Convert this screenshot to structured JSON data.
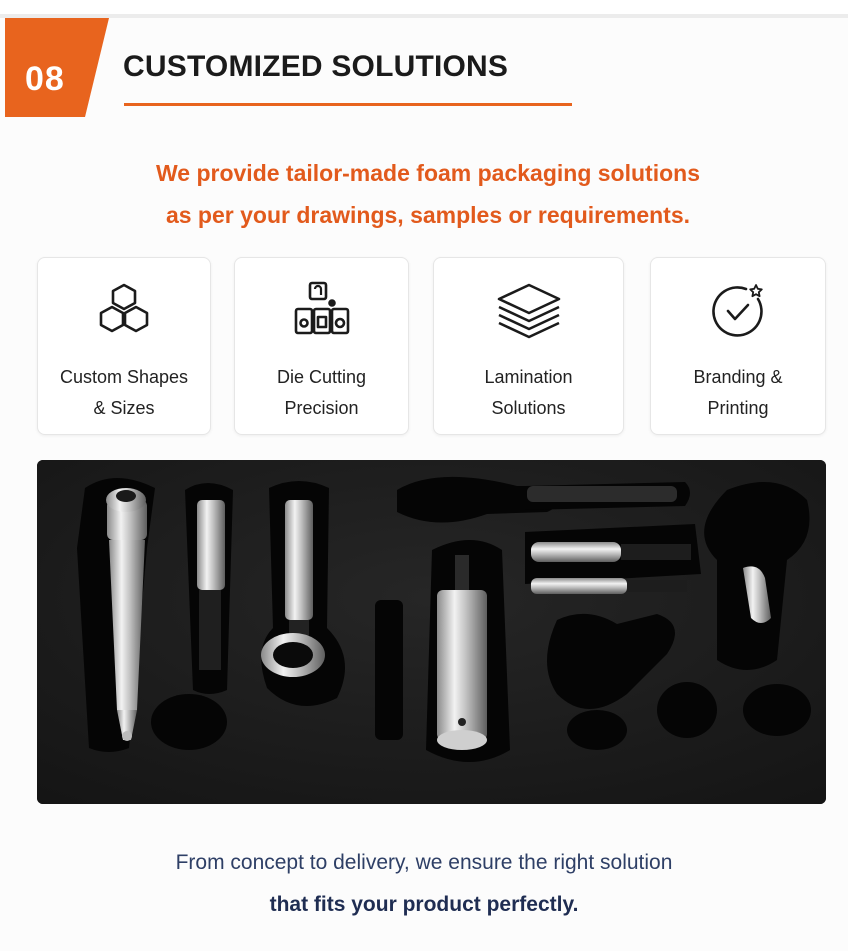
{
  "section": {
    "number": "08",
    "title": "CUSTOMIZED SOLUTIONS",
    "accent_color": "#e8641e"
  },
  "subtitle": {
    "line1": "We provide tailor-made foam packaging solutions",
    "line2": "as per your drawings, samples or requirements.",
    "color": "#e25a1c"
  },
  "features": [
    {
      "icon": "hexagon-cluster-icon",
      "line1": "Custom Shapes",
      "line2": "& Sizes"
    },
    {
      "icon": "die-cut-blocks-icon",
      "line1": "Die Cutting",
      "line2": "Precision"
    },
    {
      "icon": "layers-icon",
      "line1": "Lamination",
      "line2": "Solutions"
    },
    {
      "icon": "badge-check-icon",
      "line1": "Branding &",
      "line2": "Printing"
    }
  ],
  "photo": {
    "subject": "black foam insert tray holding metal tool parts"
  },
  "footer": {
    "line1": "From concept to delivery, we ensure the right solution",
    "line2": "that fits your product perfectly.",
    "color": "#2e3f66"
  }
}
